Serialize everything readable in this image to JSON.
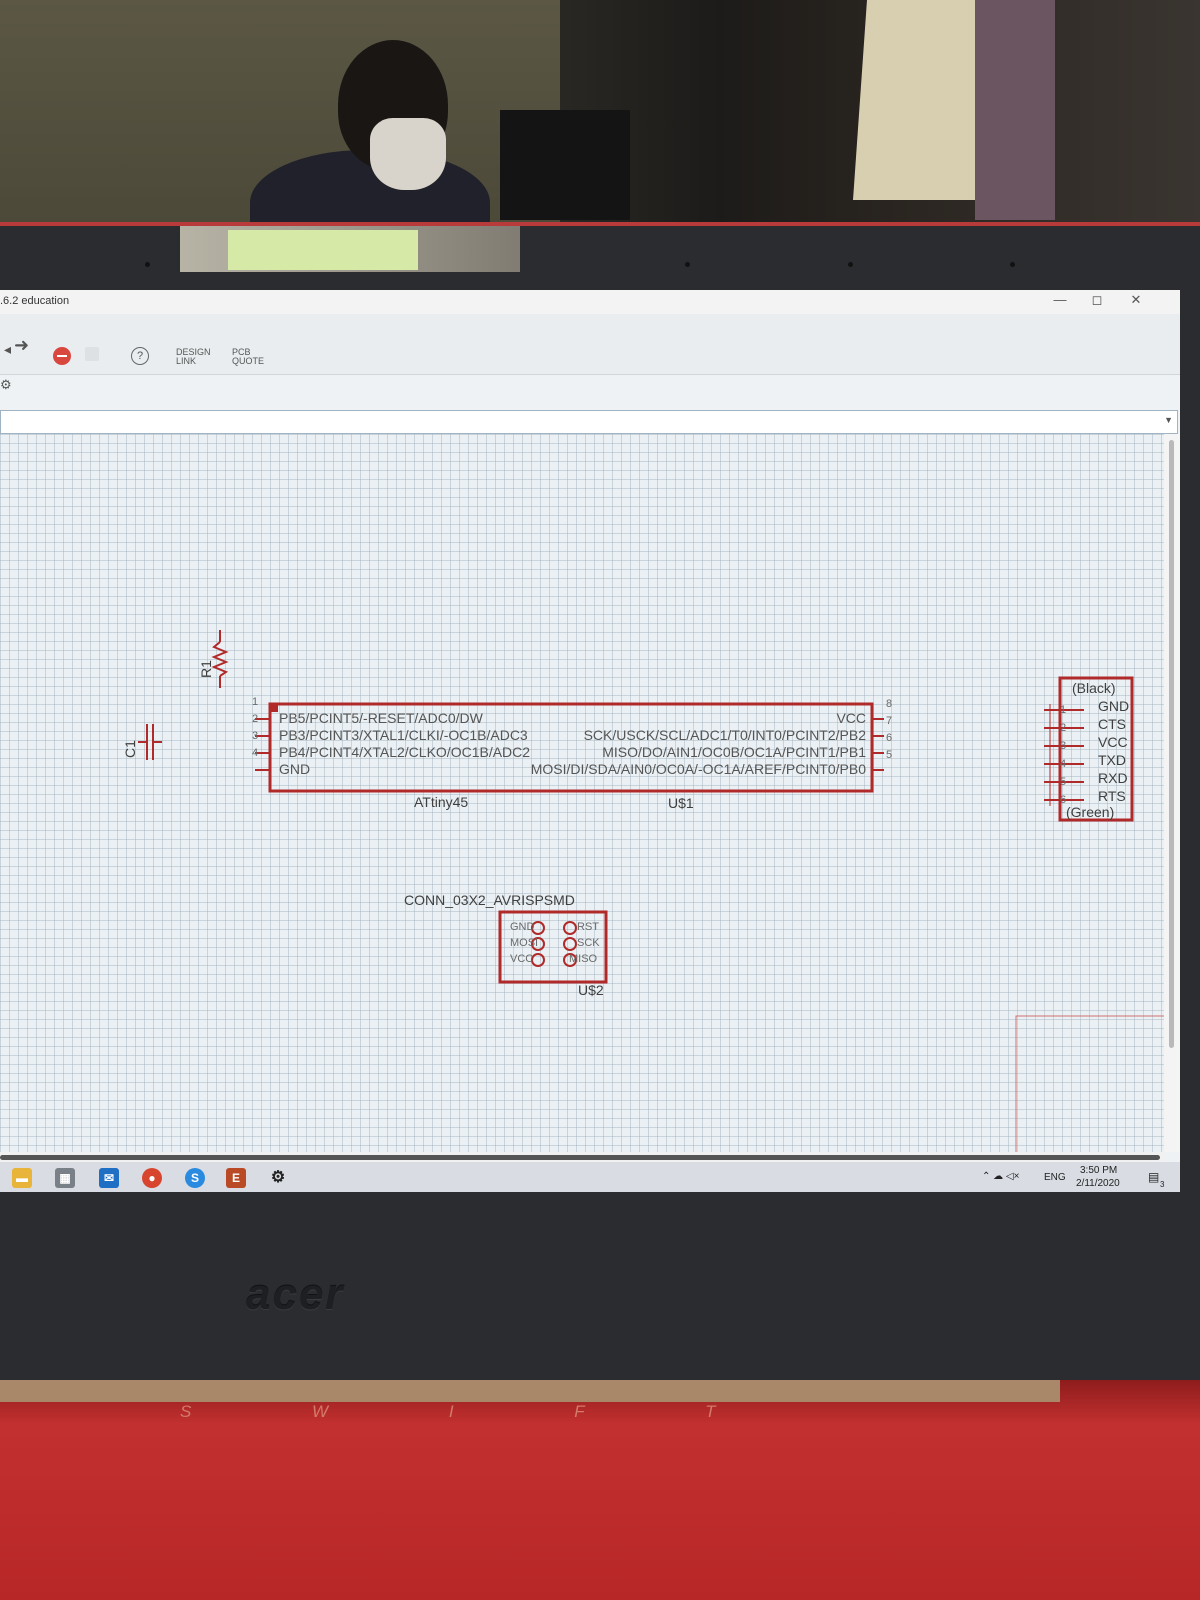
{
  "window": {
    "title": ".6.2 education",
    "controls": [
      "—",
      "◻",
      "✕"
    ]
  },
  "toolbar": {
    "design_link": "DESIGN LINK",
    "pcb_quote": "PCB QUOTE",
    "help": "?"
  },
  "schematic": {
    "resistor_name": "R1",
    "capacitor_name": "C1",
    "attiny": {
      "name": "ATtiny45",
      "ref": "U$1",
      "left_pins": [
        {
          "num": "1",
          "label": "PB5/PCINT5/-RESET/ADC0/DW"
        },
        {
          "num": "2",
          "label": "PB3/PCINT3/XTAL1/CLKI/-OC1B/ADC3"
        },
        {
          "num": "3",
          "label": "PB4/PCINT4/XTAL2/CLKO/OC1B/ADC2"
        },
        {
          "num": "4",
          "label": "GND"
        }
      ],
      "right_pins": [
        {
          "num": "8",
          "label": "VCC"
        },
        {
          "num": "7",
          "label": "SCK/USCK/SCL/ADC1/T0/INT0/PCINT2/PB2"
        },
        {
          "num": "6",
          "label": "MISO/DO/AIN1/OC0B/OC1A/PCINT1/PB1"
        },
        {
          "num": "5",
          "label": "MOSI/DI/SDA/AIN0/OC0A/-OC1A/AREF/PCINT0/PB0"
        }
      ]
    },
    "ftdi": {
      "top": "(Black)",
      "bottom": "(Green)",
      "pins": [
        {
          "num": "1",
          "label": "GND"
        },
        {
          "num": "2",
          "label": "CTS"
        },
        {
          "num": "3",
          "label": "VCC"
        },
        {
          "num": "4",
          "label": "TXD"
        },
        {
          "num": "5",
          "label": "RXD"
        },
        {
          "num": "6",
          "label": "RTS"
        }
      ]
    },
    "isp": {
      "name": "CONN_03X2_AVRISPSMD",
      "ref": "U$2",
      "left": [
        "GND",
        "MOSI",
        "VCC"
      ],
      "right": [
        "RST",
        "SCK",
        "MISO"
      ]
    }
  },
  "taskbar": {
    "apps": [
      "file-explorer",
      "store",
      "mail",
      "chrome",
      "skype",
      "eagle",
      "settings"
    ],
    "lang": "ENG",
    "time": "3:50 PM",
    "date": "2/11/2020",
    "notifications": "3"
  },
  "laptop": {
    "brand": "acer",
    "model": "S W I F T"
  },
  "colors": {
    "schematic_red": "#b02a2a",
    "canvas": "#eaf0f3"
  }
}
